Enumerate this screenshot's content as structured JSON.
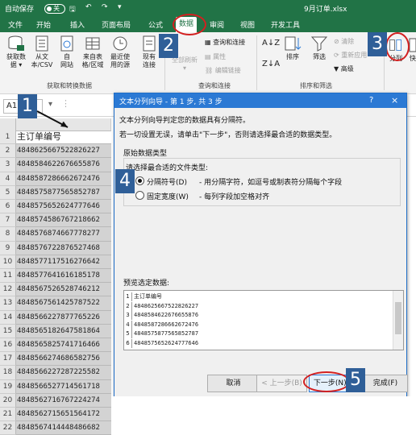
{
  "titlebar": {
    "autosave_label": "自动保存",
    "autosave_state": "关",
    "filename": "9月订单.xlsx",
    "quick_access_icons": [
      "save-icon",
      "undo-icon",
      "redo-icon"
    ]
  },
  "tabs": [
    "文件",
    "开始",
    "插入",
    "页面布局",
    "公式",
    "数据",
    "审阅",
    "视图",
    "开发工具"
  ],
  "active_tab": "数据",
  "ribbon": {
    "get_data": {
      "label1": "获取数",
      "label2": "据 ▾"
    },
    "from_text": {
      "label1": "从文",
      "label2": "本/CSV"
    },
    "from_web": {
      "label1": "自",
      "label2": "网站"
    },
    "from_table": {
      "label1": "来自表",
      "label2": "格/区域"
    },
    "recent_sources": {
      "label1": "最近使",
      "label2": "用的源"
    },
    "existing": {
      "label1": "现有",
      "label2": "连接"
    },
    "refresh_all": {
      "label1": "全部刷新",
      "label2": "▾"
    },
    "queries": "查询和连接",
    "properties": "属性",
    "edit_links": "编辑链接",
    "sort": "排序",
    "filter": "筛选",
    "clear": "清除",
    "reapply": "重新应用",
    "advanced": "高级",
    "text_to_columns": "分列",
    "flash_fill": "快",
    "group_get": "获取和转换数据",
    "group_queries": "查询和连接",
    "group_sort": "排序和筛选"
  },
  "formula_bar": {
    "name_box": "A1"
  },
  "columns": [
    "A"
  ],
  "rows": [
    {
      "num": "1",
      "value": "主订单编号"
    },
    {
      "num": "2",
      "value": "4848625667522826227"
    },
    {
      "num": "3",
      "value": "4848584622676655876"
    },
    {
      "num": "4",
      "value": "4848587286662672476"
    },
    {
      "num": "5",
      "value": "4848575877565852787"
    },
    {
      "num": "6",
      "value": "4848575652624777646"
    },
    {
      "num": "7",
      "value": "4848574586767218662"
    },
    {
      "num": "8",
      "value": "4848576874667778277"
    },
    {
      "num": "9",
      "value": "4848576722876527468"
    },
    {
      "num": "10",
      "value": "4848577117516276642"
    },
    {
      "num": "11",
      "value": "4848577641616185178"
    },
    {
      "num": "12",
      "value": "4848567526528746212"
    },
    {
      "num": "13",
      "value": "4848567561425787522"
    },
    {
      "num": "14",
      "value": "4848566227877765226"
    },
    {
      "num": "15",
      "value": "4848565182647581864"
    },
    {
      "num": "16",
      "value": "4848565825741716466"
    },
    {
      "num": "17",
      "value": "4848566274686582756"
    },
    {
      "num": "18",
      "value": "4848566227287225582"
    },
    {
      "num": "19",
      "value": "4848566527714561718"
    },
    {
      "num": "20",
      "value": "4848562716767224274"
    },
    {
      "num": "21",
      "value": "4848562715651564172"
    },
    {
      "num": "22",
      "value": "4848567414448486682"
    }
  ],
  "dialog": {
    "title": "文本分列向导 - 第 1 步, 共 3 步",
    "help": "?",
    "close": "×",
    "line1": "文本分列向导判定您的数据具有分隔符。",
    "line2": "若一切设置无误，请单击\"下一步\"，否则请选择最合适的数据类型。",
    "section": "原始数据类型",
    "prompt": "请选择最合适的文件类型:",
    "opt1_label": "分隔符号(D)",
    "opt1_desc": "- 用分隔字符，如逗号或制表符分隔每个字段",
    "opt2_label": "固定宽度(W)",
    "opt2_desc": "- 每列字段加空格对齐",
    "selected_option": "分隔符号(D)",
    "preview_label": "预览选定数据:",
    "preview_rows": [
      {
        "num": "1",
        "text": "主订单编号"
      },
      {
        "num": "2",
        "text": "4848625667522826227"
      },
      {
        "num": "3",
        "text": "4848584622676655876"
      },
      {
        "num": "4",
        "text": "4848587286662672476"
      },
      {
        "num": "5",
        "text": "4848575877565852787"
      },
      {
        "num": "6",
        "text": "4848575652624777646"
      }
    ],
    "cancel": "取消",
    "back": "< 上一步(B)",
    "next": "下一步(N) >",
    "finish": "完成(F)"
  },
  "annotations": [
    "1",
    "2",
    "3",
    "4",
    "5"
  ],
  "colors": {
    "excel_green": "#217346",
    "dialog_blue": "#2b79d4",
    "badge_blue": "#2f5f98",
    "highlight_red": "#d32020"
  }
}
